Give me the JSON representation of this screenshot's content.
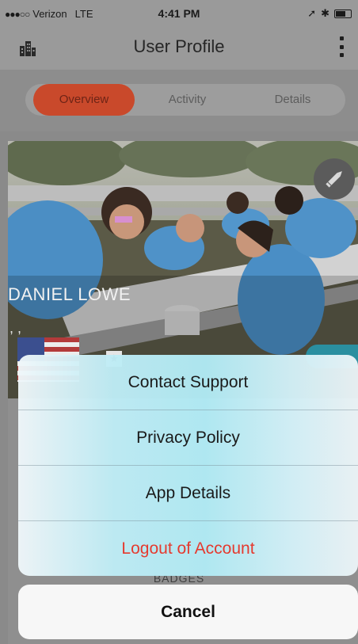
{
  "status_bar": {
    "signal": "●●●○○",
    "carrier": "Verizon",
    "network": "LTE",
    "time": "4:41 PM",
    "location_icon": "location-arrow-icon",
    "bluetooth_icon": "bluetooth-icon",
    "battery_icon": "battery-icon"
  },
  "nav": {
    "title": "User Profile",
    "left_icon": "building-icon",
    "right_icon": "vertical-menu-icon"
  },
  "tabs": [
    {
      "label": "Overview",
      "active": true
    },
    {
      "label": "Activity",
      "active": false
    },
    {
      "label": "Details",
      "active": false
    }
  ],
  "profile": {
    "name": "DANIEL LOWE",
    "quote": ", ,",
    "flag_icon": "us-flag-icon",
    "edit_icon": "pencil-icon"
  },
  "lower": {
    "badges_label": "BADGES"
  },
  "action_sheet": {
    "items": [
      {
        "label": "Contact Support",
        "style": "default"
      },
      {
        "label": "Privacy Policy",
        "style": "default"
      },
      {
        "label": "App Details",
        "style": "default"
      },
      {
        "label": "Logout of Account",
        "style": "destructive"
      }
    ],
    "cancel_label": "Cancel"
  },
  "colors": {
    "accent": "#c9492b",
    "destructive": "#e53a2f",
    "sheet_tint": "#b0eaf4"
  }
}
